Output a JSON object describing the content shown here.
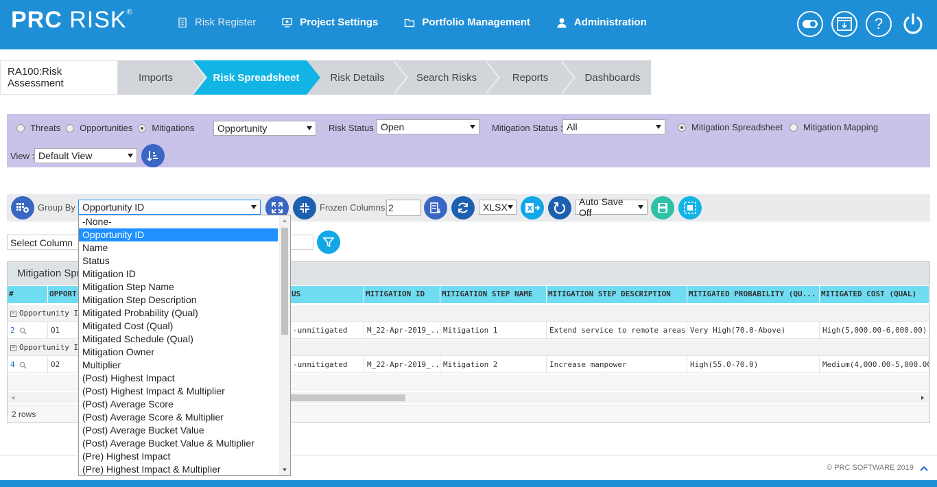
{
  "app": {
    "logo_text_bold": "PRC",
    "logo_text_light": "RISK",
    "logo_reg": "®"
  },
  "nav": [
    {
      "label": "Risk Register",
      "icon": "document-icon"
    },
    {
      "label": "Project Settings",
      "icon": "settings-screen-icon"
    },
    {
      "label": "Portfolio Management",
      "icon": "folder-icon"
    },
    {
      "label": "Administration",
      "icon": "user-icon"
    }
  ],
  "top_icons": [
    "toggle-icon",
    "download-window-icon",
    "help-icon",
    "power-icon"
  ],
  "help_glyph": "?",
  "breadcrumb": {
    "project": "RA100:Risk Assessment",
    "tabs": [
      "Imports",
      "Risk Spreadsheet",
      "Risk Details",
      "Search Risks",
      "Reports",
      "Dashboards"
    ],
    "active_tab": "Risk Spreadsheet"
  },
  "filters": {
    "type_options": [
      "Threats",
      "Opportunities",
      "Mitigations"
    ],
    "type_selected": "Mitigations",
    "type_select_value": "Opportunity",
    "risk_status_label": "Risk Status :",
    "risk_status_value": "Open",
    "mitigation_status_label": "Mitigation Status :",
    "mitigation_status_value": "All",
    "view_modes": [
      "Mitigation Spreadsheet",
      "Mitigation Mapping"
    ],
    "view_mode_selected": "Mitigation Spreadsheet",
    "view_label": "View :",
    "view_value": "Default View"
  },
  "toolbar": {
    "group_by_label": "Group By :",
    "group_by_value": "Opportunity ID",
    "frozen_label": "Frozen Columns :",
    "frozen_value": "2",
    "export_format": "XLSX",
    "auto_save": "Auto Save Off"
  },
  "column_select": "Select Column",
  "grid": {
    "title": "Mitigation Spr",
    "headers": [
      "#",
      "OPPORT",
      "US",
      "MITIGATION ID",
      "MITIGATION STEP NAME",
      "MITIGATION STEP DESCRIPTION",
      "MITIGATED PROBABILITY (QU...",
      "MITIGATED COST (QUAL)"
    ],
    "group_label": "Opportunity ID:",
    "rows": [
      {
        "num": "2",
        "opp": "O1",
        "status": "-unmitigated",
        "mid": "M_22-Apr-2019_...",
        "step": "Mitigation 1",
        "desc": "Extend service to remote areas",
        "prob": "Very High(70.0-Above)",
        "cost": "High(5,000.00-6,000.00)"
      },
      {
        "num": "4",
        "opp": "O2",
        "status": "-unmitigated",
        "mid": "M_22-Apr-2019_...",
        "step": "Mitigation 2",
        "desc": "Increase manpower",
        "prob": "High(55.0-70.0)",
        "cost": "Medium(4,000.00-5,000.00"
      }
    ],
    "row_count": "2 rows"
  },
  "dropdown": {
    "selected": "Opportunity ID",
    "options": [
      "-None-",
      "Opportunity ID",
      "Name",
      "Status",
      "Mitigation ID",
      "Mitigation Step Name",
      "Mitigation Step Description",
      "Mitigated Probability (Qual)",
      "Mitigated Cost (Qual)",
      "Mitigated Schedule (Qual)",
      "Mitigation Owner",
      "Multiplier",
      "(Post) Highest Impact",
      "(Post) Highest Impact & Multiplier",
      "(Post) Average Score",
      "(Post) Average Score & Multiplier",
      "(Post) Average Bucket Value",
      "(Post) Average Bucket Value & Multiplier",
      "(Pre) Highest Impact",
      "(Pre) Highest Impact & Multiplier"
    ]
  },
  "footer": {
    "copyright": "© PRC SOFTWARE 2019"
  },
  "colors": {
    "brand_blue": "#1e8fd6",
    "active_tab": "#12b4e6",
    "filter_bg": "#c9c3ea",
    "grid_header": "#6fdcf2",
    "button_dark": "#3a66c4",
    "button_teal": "#2fc1a6"
  }
}
